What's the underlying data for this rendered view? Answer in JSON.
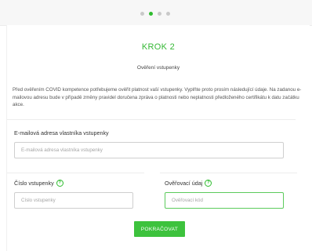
{
  "progress": {
    "total_steps": 4,
    "current_step": 2
  },
  "step": {
    "title": "KROK 2",
    "subtitle": "Ověření vstupenky"
  },
  "intro_text": "Před ověřením COVID kompetence potřebujeme ověřit platnost vaší vstupenky. Vyplňte proto prosím následující údaje. Na zadanou e-mailovou adresu bude v případě změny pravidel doručena zpráva o platnosti nebo neplatnosti předloženého certifikátu k datu začátku akce.",
  "form": {
    "email": {
      "label": "E-mailová adresa vlastníka vstupenky",
      "placeholder": "E-mailová adresa vlastníka vstupenky",
      "value": ""
    },
    "ticket_number": {
      "label": "Číslo vstupenky",
      "placeholder": "Číslo vstupenky",
      "value": "",
      "help_icon": "question-circle-icon"
    },
    "verification": {
      "label": "Ověřovací údaj",
      "placeholder": "Ověřovací kód",
      "value": "",
      "help_icon": "question-circle-icon"
    },
    "submit_label": "POKRAČOVAT"
  },
  "colors": {
    "accent": "#3dc23d",
    "dot_inactive": "#c9c9c9"
  }
}
